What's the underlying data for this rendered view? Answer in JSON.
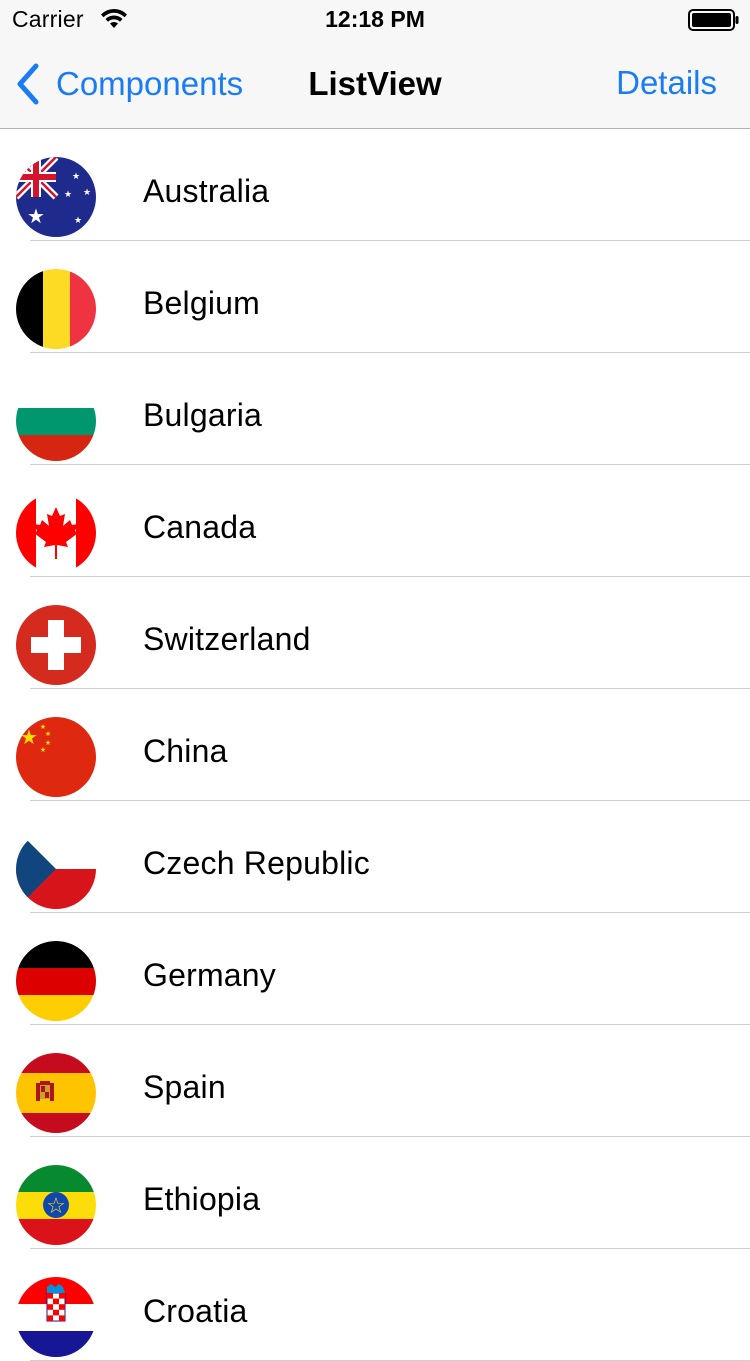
{
  "status_bar": {
    "carrier": "Carrier",
    "time": "12:18 PM",
    "wifi_icon": "wifi-icon",
    "battery_icon": "battery-icon"
  },
  "nav": {
    "back_label": "Components",
    "back_icon": "chevron-left-icon",
    "title": "ListView",
    "right_label": "Details",
    "accent_color": "#1a7cf5"
  },
  "countries": [
    {
      "name": "Australia",
      "flag_icon": "australia-flag-icon"
    },
    {
      "name": "Belgium",
      "flag_icon": "belgium-flag-icon"
    },
    {
      "name": "Bulgaria",
      "flag_icon": "bulgaria-flag-icon"
    },
    {
      "name": "Canada",
      "flag_icon": "canada-flag-icon"
    },
    {
      "name": "Switzerland",
      "flag_icon": "switzerland-flag-icon"
    },
    {
      "name": "China",
      "flag_icon": "china-flag-icon"
    },
    {
      "name": "Czech Republic",
      "flag_icon": "czech-republic-flag-icon"
    },
    {
      "name": "Germany",
      "flag_icon": "germany-flag-icon"
    },
    {
      "name": "Spain",
      "flag_icon": "spain-flag-icon"
    },
    {
      "name": "Ethiopia",
      "flag_icon": "ethiopia-flag-icon"
    },
    {
      "name": "Croatia",
      "flag_icon": "croatia-flag-icon"
    }
  ]
}
